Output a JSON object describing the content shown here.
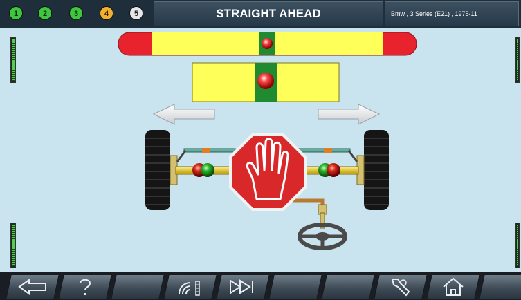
{
  "header": {
    "steps": [
      "1",
      "2",
      "3",
      "4",
      "5"
    ],
    "title": "STRAIGHT AHEAD",
    "vehicle": "Bmw , 3 Series (E21)  , 1975-11"
  },
  "toolbar": {
    "buttons": [
      {
        "name": "back",
        "icon": "back-arrow-icon"
      },
      {
        "name": "help",
        "icon": "question-icon"
      },
      {
        "name": "blank-1",
        "icon": ""
      },
      {
        "name": "sensor",
        "icon": "wireless-sensor-icon"
      },
      {
        "name": "next",
        "icon": "fast-forward-icon"
      },
      {
        "name": "blank-2",
        "icon": ""
      },
      {
        "name": "blank-3",
        "icon": ""
      },
      {
        "name": "tools",
        "icon": "wrench-icon"
      },
      {
        "name": "home",
        "icon": "home-icon"
      },
      {
        "name": "blank-4",
        "icon": ""
      }
    ]
  },
  "colors": {
    "background": "#c9e3ef",
    "bar_yellow": "#ffff5a",
    "bar_red": "#e8232e",
    "indicator_green": "#1f8a2f",
    "stop_sign": "#d8282a"
  },
  "status": {
    "steps_state": [
      "done",
      "done",
      "done",
      "active",
      "todo"
    ]
  }
}
